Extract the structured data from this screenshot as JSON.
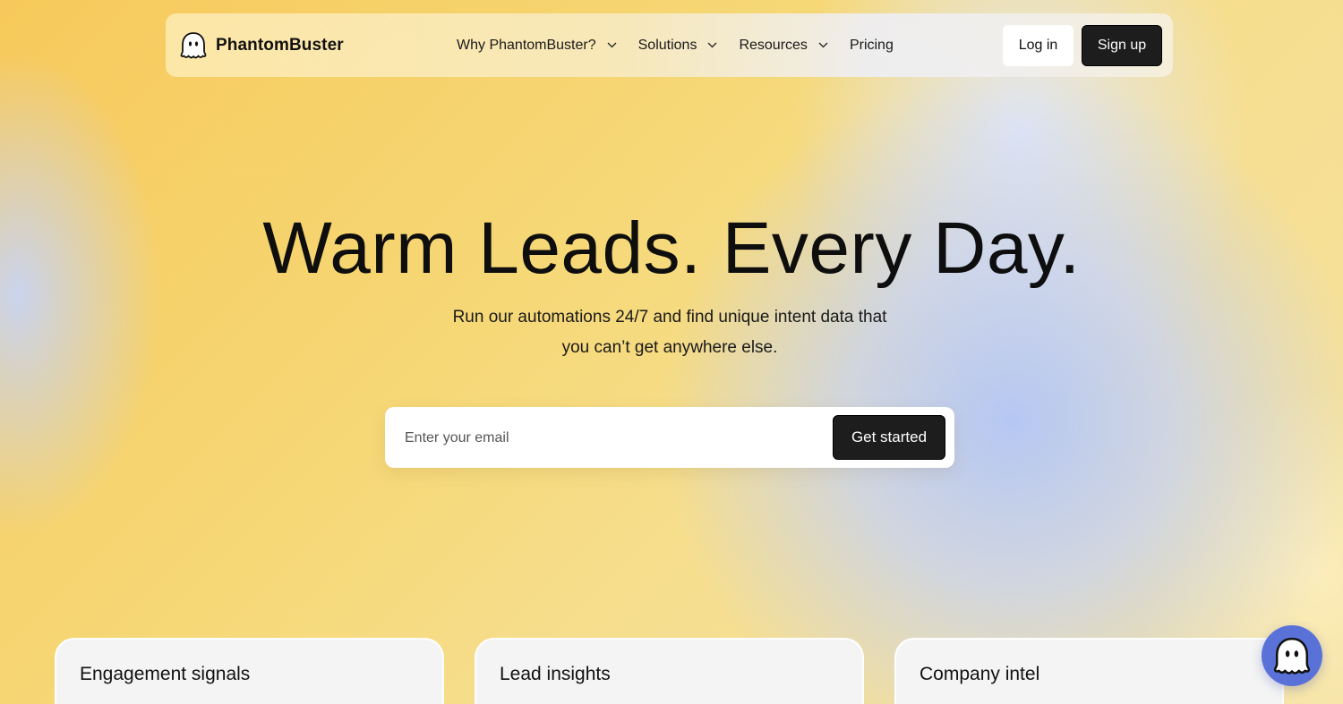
{
  "nav": {
    "brand": "PhantomBuster",
    "links": [
      {
        "label": "Why PhantomBuster?",
        "has_dropdown": true
      },
      {
        "label": "Solutions",
        "has_dropdown": true
      },
      {
        "label": "Resources",
        "has_dropdown": true
      },
      {
        "label": "Pricing",
        "has_dropdown": false
      }
    ],
    "login_label": "Log in",
    "signup_label": "Sign up"
  },
  "hero": {
    "title": "Warm Leads. Every Day.",
    "subtitle_line1": "Run our automations 24/7 and find unique intent data that",
    "subtitle_line2": "you can’t get anywhere else.",
    "email_placeholder": "Enter your email",
    "cta_label": "Get started"
  },
  "cards": [
    {
      "title": "Engagement signals"
    },
    {
      "title": "Lead insights"
    },
    {
      "title": "Company intel"
    }
  ],
  "icons": {
    "brand_logo": "ghost-logo-icon",
    "dropdown": "chevron-down-icon",
    "chat": "ghost-chat-icon"
  },
  "colors": {
    "primary_button": "#1d1d1d",
    "chat_bubble": "#5a72d8",
    "background_warm": "#f6d877",
    "background_cool": "#c4d2f8"
  }
}
